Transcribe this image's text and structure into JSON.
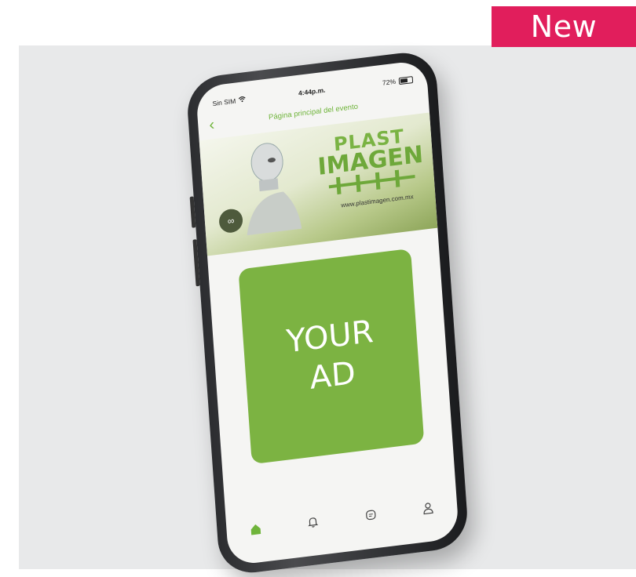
{
  "badge": {
    "label": "New"
  },
  "status_bar": {
    "carrier": "Sin SIM",
    "time": "4:44p.m.",
    "battery": "72%"
  },
  "nav": {
    "title": "Página principal del evento"
  },
  "banner": {
    "brand_line1": "PLAST",
    "brand_line2": "IMAGEN",
    "url": "www.plastimagen.com.mx"
  },
  "ad": {
    "line1": "YOUR",
    "line2": "AD"
  },
  "tabbar": {
    "items": [
      {
        "icon": "home-icon",
        "active": true
      },
      {
        "icon": "bell-icon",
        "active": false
      },
      {
        "icon": "message-icon",
        "active": false
      },
      {
        "icon": "user-icon",
        "active": false
      }
    ]
  },
  "colors": {
    "accent": "#7cb342",
    "badge": "#e11e5c",
    "backdrop": "#e8e9ea"
  }
}
